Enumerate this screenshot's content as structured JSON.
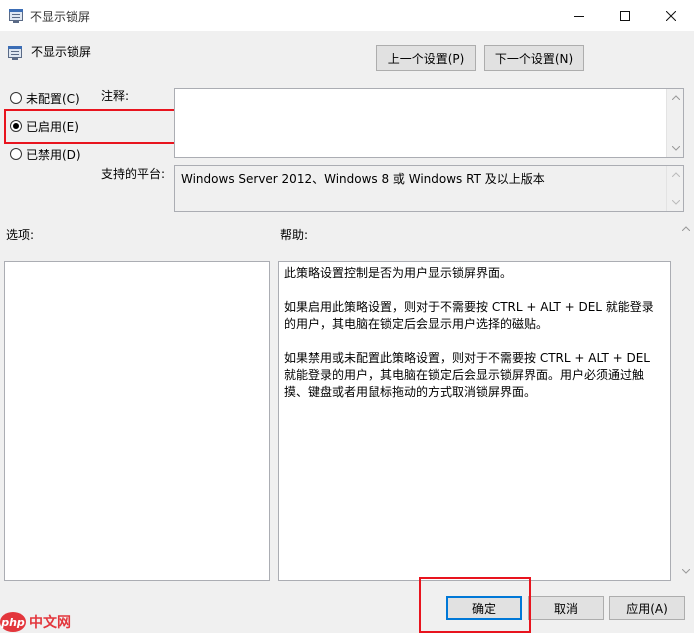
{
  "window": {
    "title": "不显示锁屏"
  },
  "header": {
    "policy_name": "不显示锁屏",
    "prev_setting": "上一个设置(P)",
    "next_setting": "下一个设置(N)"
  },
  "state": {
    "options": [
      {
        "label": "未配置(C)",
        "checked": false
      },
      {
        "label": "已启用(E)",
        "checked": true
      },
      {
        "label": "已禁用(D)",
        "checked": false
      }
    ]
  },
  "comment": {
    "label": "注释:",
    "value": ""
  },
  "platform": {
    "label": "支持的平台:",
    "value": "Windows Server 2012、Windows 8 或 Windows RT 及以上版本"
  },
  "options_section": {
    "label": "选项:"
  },
  "help_section": {
    "label": "帮助:",
    "paragraphs": [
      "此策略设置控制是否为用户显示锁屏界面。",
      "如果启用此策略设置，则对于不需要按 CTRL + ALT + DEL 就能登录的用户，其电脑在锁定后会显示用户选择的磁贴。",
      "如果禁用或未配置此策略设置，则对于不需要按 CTRL + ALT + DEL 就能登录的用户，其电脑在锁定后会显示锁屏界面。用户必须通过触摸、键盘或者用鼠标拖动的方式取消锁屏界面。"
    ]
  },
  "footer": {
    "ok": "确定",
    "cancel": "取消",
    "apply": "应用(A)"
  },
  "watermark": {
    "badge": "php",
    "text": "中文网"
  },
  "colors": {
    "highlight_red": "#e8141e",
    "focus_blue": "#0078d7"
  }
}
